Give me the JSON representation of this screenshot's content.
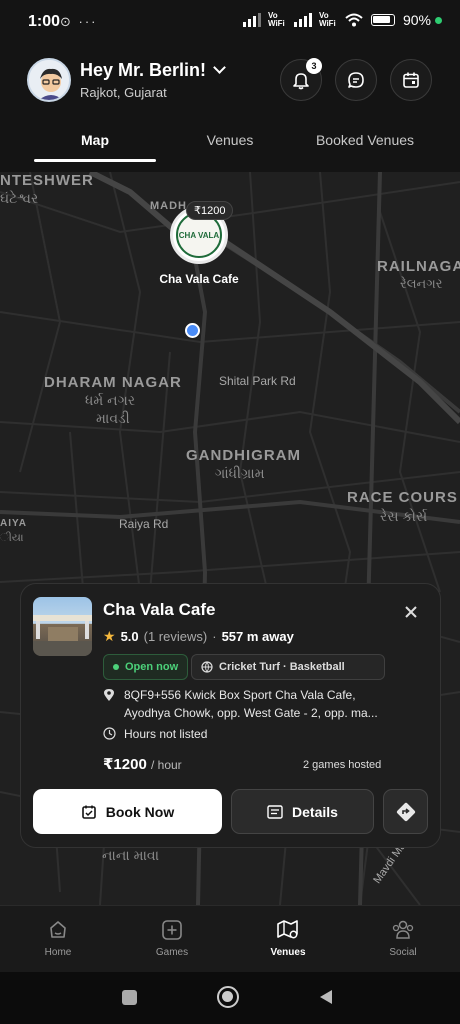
{
  "status": {
    "time": "1:00",
    "signal1_label": "Vo WiFi",
    "signal2_label": "Vo WiFi",
    "battery": "90%"
  },
  "header": {
    "greeting": "Hey Mr. Berlin!",
    "location": "Rajkot, Gujarat",
    "notification_count": "3"
  },
  "tabs": [
    {
      "label": "Map",
      "active": true
    },
    {
      "label": "Venues",
      "active": false
    },
    {
      "label": "Booked Venues",
      "active": false
    }
  ],
  "map": {
    "labels": {
      "nteshwer": "NTESHWER",
      "nteshwer_gu": "ઘંટેશ્વર",
      "madh": "MADH",
      "railnagar": "RAILNAGA",
      "railnagar_gu": "રેલનગર",
      "dharam": "DHARAM NAGAR",
      "dharam_gu1": "ધર્મ નગર",
      "dharam_gu2": "માવડી",
      "shital": "Shital Park Rd",
      "gandhigram": "GANDHIGRAM",
      "gandhigram_gu": "ગાંધીગ્રામ",
      "racecourse": "RACE COURS",
      "racecourse_gu": "રેસ કોર્સ",
      "aiya": "AIYA",
      "aiya_gu": "ીયા",
      "raiya_rd": "Raiya Rd",
      "nana_mava": "નાના માવા",
      "mavdi": "Mavdi Ma"
    },
    "pin": {
      "price": "₹1200",
      "logo_text": "CHA VALA",
      "name": "Cha Vala Cafe"
    }
  },
  "card": {
    "title": "Cha Vala Cafe",
    "rating": "5.0",
    "reviews": "(1 reviews)",
    "separator": "·",
    "distance": "557 m away",
    "status": "Open now",
    "sports": "Cricket Turf · Basketball",
    "address_line1": "8QF9+556 Kwick Box Sport Cha Vala Cafe,",
    "address_line2": "Ayodhya Chowk, opp. West Gate - 2, opp. ma...",
    "hours": "Hours not listed",
    "price": "₹1200",
    "price_unit": "/ hour",
    "games_hosted": "2 games hosted",
    "book_label": "Book Now",
    "details_label": "Details"
  },
  "bottom_nav": [
    {
      "label": "Home",
      "icon": "home-icon",
      "active": false
    },
    {
      "label": "Games",
      "icon": "plus-square-icon",
      "active": false
    },
    {
      "label": "Venues",
      "icon": "map-pin-icon",
      "active": true
    },
    {
      "label": "Social",
      "icon": "people-icon",
      "active": false
    }
  ],
  "colors": {
    "background": "#141414",
    "map": "#202020",
    "accent_green": "#4cd17a",
    "location_dot": "#4a8cf7"
  }
}
